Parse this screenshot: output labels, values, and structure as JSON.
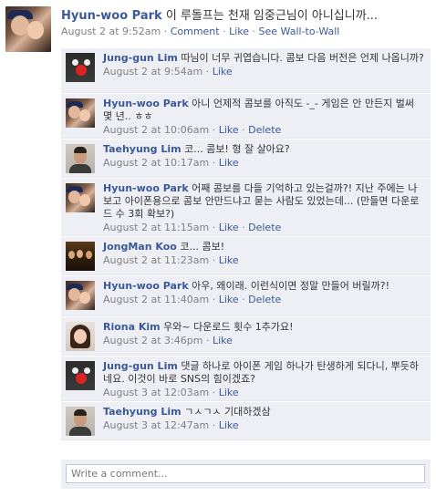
{
  "post": {
    "author": "Hyun-woo Park",
    "text": "이 루돌프는 천재 임중근님이 아니십니까...",
    "time": "August 2 at 9:52am",
    "dot": "·",
    "comment_label": "Comment",
    "like_label": "Like",
    "wall_label": "See Wall-to-Wall"
  },
  "comments": [
    {
      "author": "Jung-gun Lim",
      "text": "따님이 너무 귀엽습니다. 콤보 다음 버전은 언제 나옵니까?",
      "time": "August 2 at 9:54am",
      "like": "Like",
      "delete": "",
      "avatar": "jung-gun-lim"
    },
    {
      "author": "Hyun-woo Park",
      "text": "아니 언제적 콤보를 아직도 -_- 게임은 안 만든지 벌써 몇 년.. ㅎㅎ",
      "time": "August 2 at 10:06am",
      "like": "Like",
      "delete": "Delete",
      "avatar": "hyun-woo-park"
    },
    {
      "author": "Taehyung Lim",
      "text": "코... 콤보! 형 잘 살아요?",
      "time": "August 2 at 10:17am",
      "like": "Like",
      "delete": "",
      "avatar": "taehyung-lim"
    },
    {
      "author": "Hyun-woo Park",
      "text": "어째 콤보를 다들 기억하고 있는걸까?! 지난 주에는 나보고 아이폰용으로 콤보 안만드냐고 묻는 사람도 있었는데... (만들면 다운로드 수 3회 확보?)",
      "time": "August 2 at 11:15am",
      "like": "Like",
      "delete": "Delete",
      "avatar": "hyun-woo-park"
    },
    {
      "author": "JongMan Koo",
      "text": "코... 콤보!",
      "time": "August 2 at 11:23am",
      "like": "Like",
      "delete": "",
      "avatar": "jongman-koo"
    },
    {
      "author": "Hyun-woo Park",
      "text": "아우, 왜이래. 이런식이면 정말 만들어 버릴까?!",
      "time": "August 2 at 11:40am",
      "like": "Like",
      "delete": "Delete",
      "avatar": "hyun-woo-park"
    },
    {
      "author": "Riona Kim",
      "text": "우와~ 다운로드 횟수 1추가요!",
      "time": "August 2 at 3:46pm",
      "like": "Like",
      "delete": "",
      "avatar": "riona-kim"
    },
    {
      "author": "Jung-gun Lim",
      "text": "댓글 하나로 아이폰 게임 하나가 탄생하게 되다니, 뿌듯하네요. 이것이 바로 SNS의 힘이겠죠?",
      "time": "August 3 at 12:03am",
      "like": "Like",
      "delete": "",
      "avatar": "jung-gun-lim"
    },
    {
      "author": "Taehyung Lim",
      "text": "ㄱㅅㄱㅅ 기대하겠삼",
      "time": "August 3 at 12:47am",
      "like": "Like",
      "delete": "",
      "avatar": "taehyung-lim"
    }
  ],
  "write_comment": {
    "placeholder": "Write a comment..."
  }
}
